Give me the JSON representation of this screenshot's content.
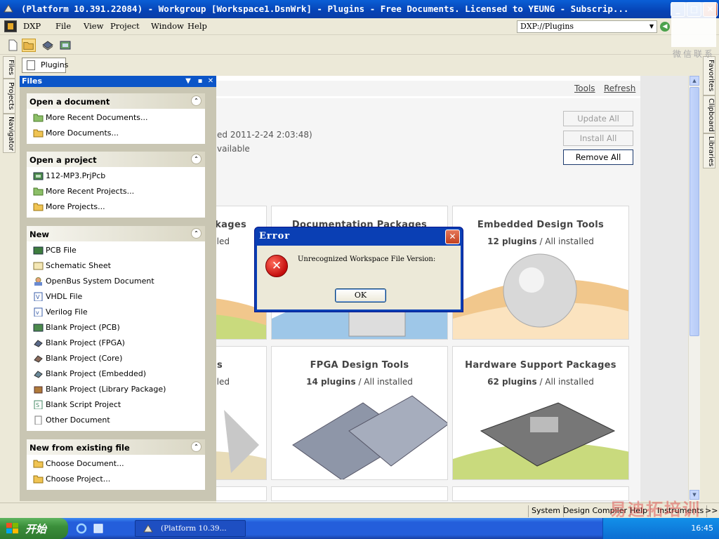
{
  "window": {
    "title": "(Platform 10.391.22084) - Workgroup [Workspace1.DsnWrk] - Plugins - Free Documents. Licensed to YEUNG - Subscrip...",
    "min_symbol": "_",
    "max_symbol": "□",
    "close_symbol": "✕"
  },
  "menu": {
    "dxp": "DXP",
    "items": [
      "File",
      "View",
      "Project",
      "Window",
      "Help"
    ],
    "address": "DXP://Plugins"
  },
  "left_dock": {
    "tabs": [
      "Files",
      "Projects",
      "Navigator"
    ]
  },
  "right_dock": {
    "tabs": [
      "Favorites",
      "Clipboard",
      "Libraries"
    ]
  },
  "doc_tab": {
    "label": "Plugins"
  },
  "files_panel": {
    "title": "Files",
    "sections": [
      {
        "title": "Open a document",
        "items": [
          "More Recent Documents...",
          "More Documents..."
        ]
      },
      {
        "title": "Open a project",
        "items": [
          "112-MP3.PrjPcb",
          "More Recent Projects...",
          "More Projects..."
        ]
      },
      {
        "title": "New",
        "items": [
          "PCB File",
          "Schematic Sheet",
          "OpenBus System Document",
          "VHDL File",
          "Verilog File",
          "Blank Project (PCB)",
          "Blank Project (FPGA)",
          "Blank Project (Core)",
          "Blank Project (Embedded)",
          "Blank Project (Library Package)",
          "Blank Script Project",
          "Other Document"
        ]
      },
      {
        "title": "New from existing file",
        "items": [
          "Choose Document...",
          "Choose Project..."
        ]
      }
    ]
  },
  "plugins": {
    "links": {
      "tools": "Tools",
      "refresh": "Refresh"
    },
    "info_line1": "ed 2011-2-24 2:03:48)",
    "info_line2": "vailable",
    "buttons": {
      "update_all": "Update All",
      "install_all": "Install All",
      "remove_all": "Remove All"
    },
    "tiles": [
      {
        "title": "kages",
        "count": "",
        "status": "lled"
      },
      {
        "title": "Documentation Packages",
        "count": "",
        "status": ""
      },
      {
        "title": "Embedded Design Tools",
        "count": "12 plugins",
        "status": "/ All installed"
      },
      {
        "title": "s",
        "count": "",
        "status": "lled"
      },
      {
        "title": "FPGA Design Tools",
        "count": "14 plugins",
        "status": "/ All installed"
      },
      {
        "title": "Hardware Support Packages",
        "count": "62 plugins",
        "status": "/ All installed"
      }
    ]
  },
  "dialog": {
    "title": "Error",
    "message": "Unrecognized Workspace File Version:",
    "ok": "OK",
    "icon_glyph": "✕"
  },
  "status_bar": {
    "items": [
      "System",
      "Design Compiler",
      "Help",
      "Instruments"
    ],
    "more": ">>"
  },
  "taskbar": {
    "start": "开始",
    "task": "(Platform 10.39...",
    "clock": "16:45"
  },
  "watermark": {
    "text": "易迪拓培训",
    "qr_label": "微信联系"
  },
  "colors": {
    "titlebar": "#0a5fd6",
    "panel_header": "#0b55c8",
    "accent_button": "#1c3a6e"
  }
}
